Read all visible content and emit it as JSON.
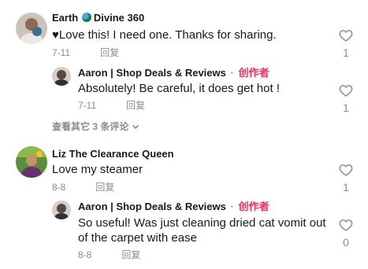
{
  "comments": [
    {
      "author": "Earth",
      "author_suffix": "Divine 360",
      "text": "♥Love this! I need one. Thanks for sharing.",
      "date": "7-11",
      "reply_label": "回复",
      "likes": "1",
      "replies": [
        {
          "author": "Aaron | Shop Deals & Reviews",
          "separator": "·",
          "badge": "创作者",
          "text": "Absolutely! Be careful, it does get hot !",
          "date": "7-11",
          "reply_label": "回复",
          "likes": "1"
        }
      ],
      "view_more": "查看其它 3 条评论"
    },
    {
      "author": "Liz The Clearance Queen",
      "text": "Love my steamer",
      "date": "8-8",
      "reply_label": "回复",
      "likes": "1",
      "replies": [
        {
          "author": "Aaron | Shop Deals & Reviews",
          "separator": "·",
          "badge": "创作者",
          "text_line1": "So useful! Was just cleaning dried cat vomit out",
          "text_line2": "of the carpet with ease",
          "date": "8-8",
          "reply_label": "回复",
          "likes": "0"
        }
      ]
    }
  ],
  "colors": {
    "text": "#161823",
    "muted": "#8a8b91",
    "creator_badge": "#fe2c55"
  },
  "icons": {
    "like": "heart-outline-icon",
    "expand": "chevron-down-icon",
    "globe": "globe-emoji-icon"
  }
}
